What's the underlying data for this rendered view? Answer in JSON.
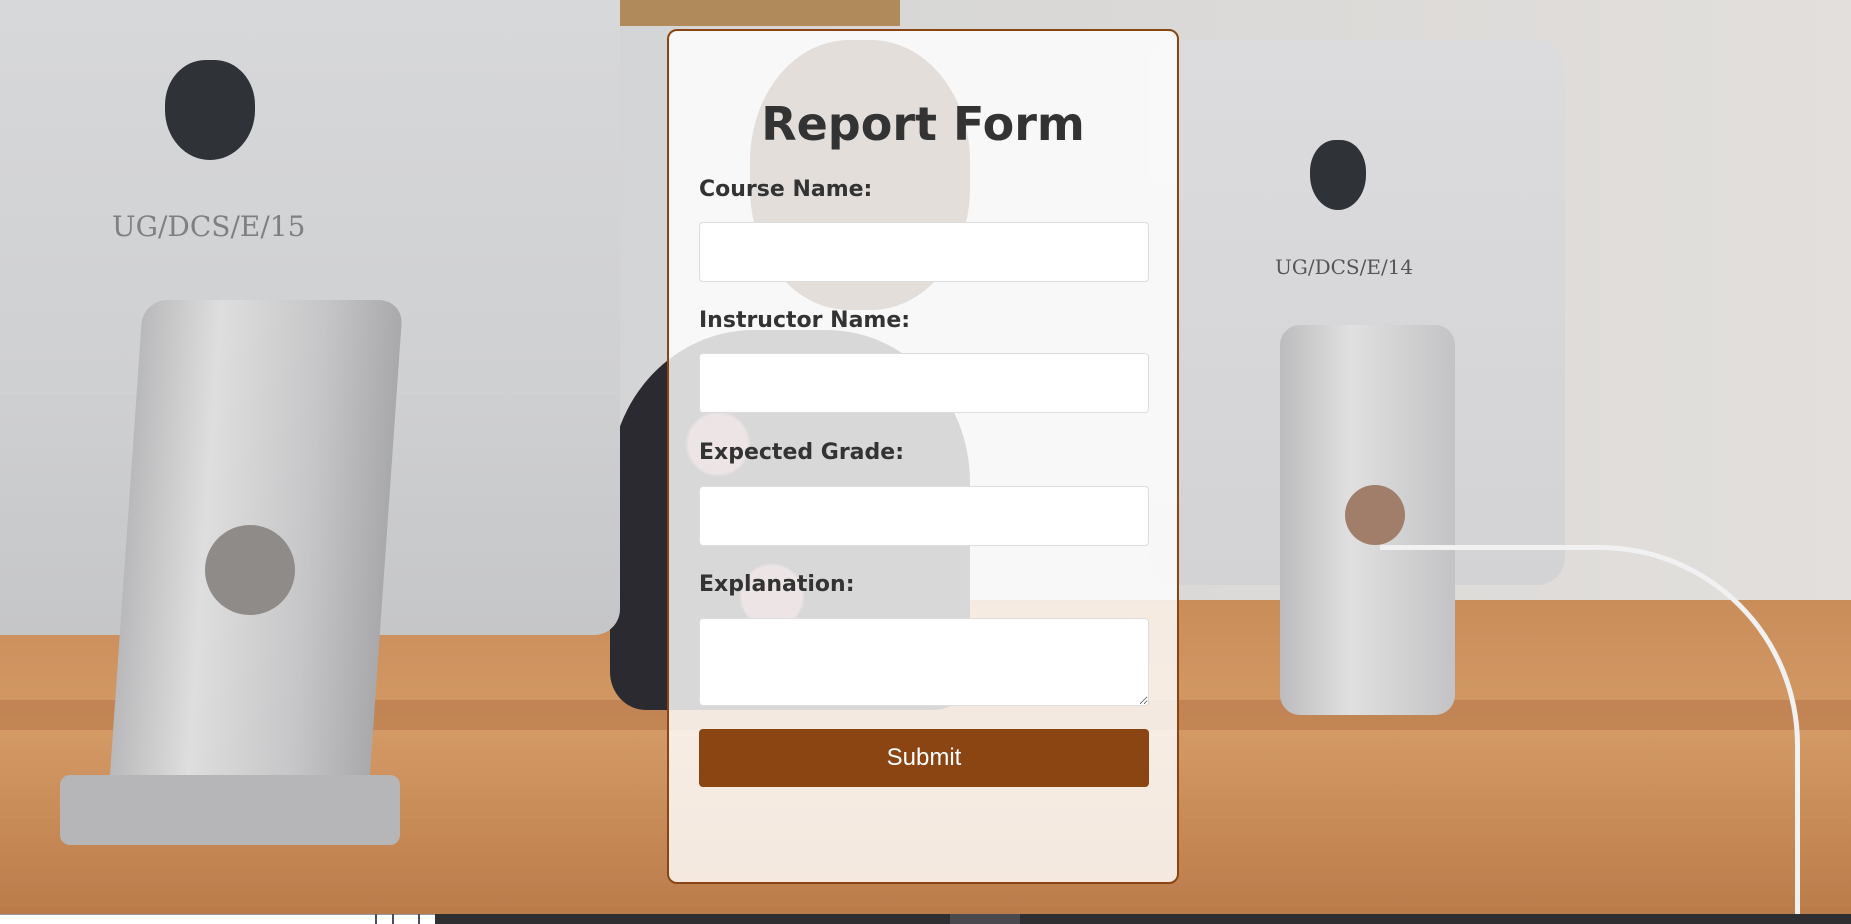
{
  "form": {
    "title": "Report Form",
    "fields": [
      {
        "label": "Course Name:",
        "value": "",
        "type": "text"
      },
      {
        "label": "Instructor Name:",
        "value": "",
        "type": "text"
      },
      {
        "label": "Expected Grade:",
        "value": "",
        "type": "text"
      },
      {
        "label": "Explanation:",
        "value": "",
        "type": "textarea"
      }
    ],
    "submit_label": "Submit"
  },
  "background": {
    "left_monitor_label": "UG/DCS/E/15",
    "right_monitor_label": "UG/DCS/E/14"
  },
  "colors": {
    "accent": "#8b4513",
    "title_text": "#333333",
    "card_bg": "rgba(255,255,255,0.82)"
  }
}
